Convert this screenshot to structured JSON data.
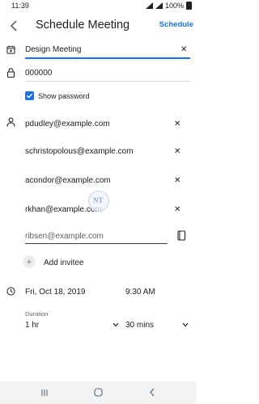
{
  "status_bar": {
    "time": "11:39",
    "battery": "100%"
  },
  "app_bar": {
    "title": "Schedule Meeting",
    "schedule_label": "Schedule"
  },
  "form": {
    "meeting_title": "Design Meeting",
    "password": "000000",
    "show_password_label": "Show password",
    "show_password_checked": true,
    "invitees": [
      "pdudley@example.com",
      "schristopolous@example.com",
      "acondor@example.com",
      "rkhan@example.com"
    ],
    "invitee_input_value": "ribsen@example.com",
    "add_invitee_label": "Add invitee",
    "date": "Fri, Oct 18, 2019",
    "time": "9:30 AM",
    "duration_label": "Duration",
    "duration_hours": "1 hr",
    "duration_minutes": "30 mins"
  },
  "watermark": {
    "text": "NT"
  },
  "colors": {
    "accent": "#1a73e8",
    "text": "#202124",
    "secondary": "#5f6368"
  },
  "icons": {
    "back": "arrow-back-icon",
    "calendar_add": "calendar-add-icon",
    "lock": "lock-icon",
    "person": "person-icon",
    "clock": "clock-icon",
    "contacts": "contacts-book-icon"
  }
}
